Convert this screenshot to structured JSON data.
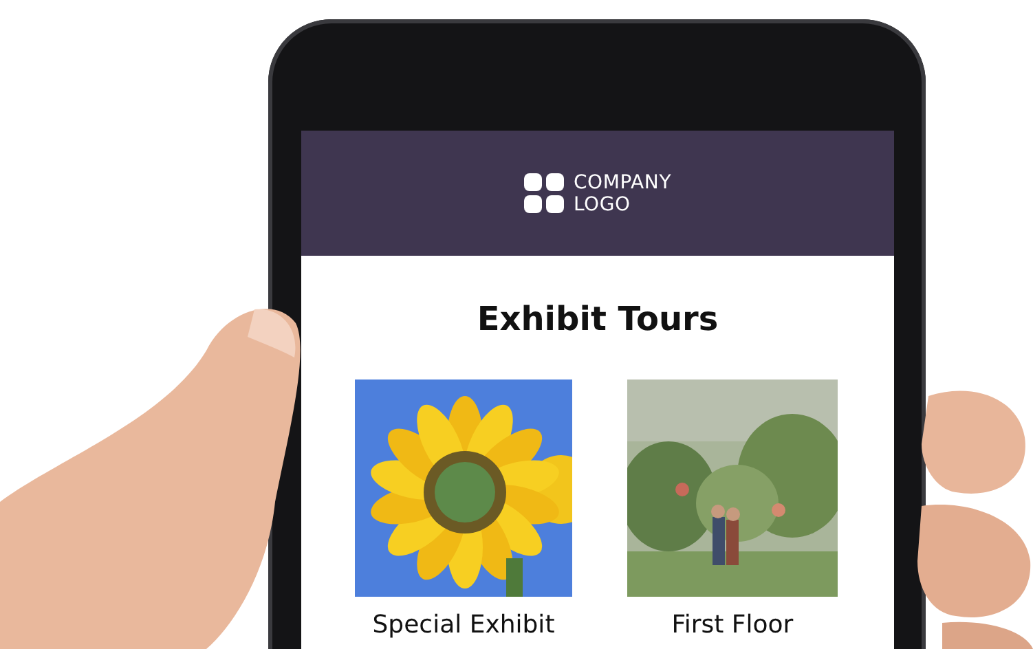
{
  "header": {
    "logo_lines": [
      "COMPANY",
      "LOGO"
    ]
  },
  "title": "Exhibit Tours",
  "tours": [
    {
      "label": "Special Exhibit"
    },
    {
      "label": "First Floor"
    }
  ]
}
